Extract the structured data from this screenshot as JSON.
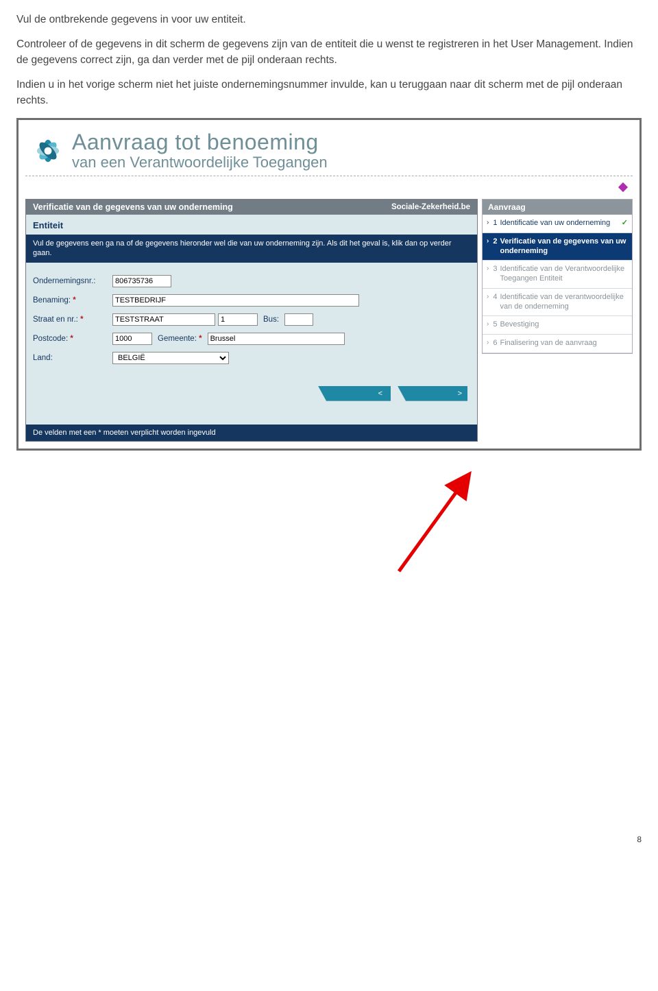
{
  "doc": {
    "para1": "Vul de ontbrekende gegevens in voor uw entiteit.",
    "para2": "Controleer of de gegevens in dit scherm de gegevens zijn van de entiteit die u wenst te registreren in het User Management. Indien de gegevens correct zijn, ga dan verder met de pijl onderaan rechts.",
    "para3": "Indien u in het vorige scherm niet het juiste ondernemingsnummer invulde, kan u teruggaan naar dit scherm met de pijl onderaan rechts.",
    "page_number": "8"
  },
  "header": {
    "title_big": "Aanvraag tot benoeming",
    "title_small": "van een Verantwoordelijke Toegangen"
  },
  "panel": {
    "title": "Verificatie van de gegevens van uw onderneming",
    "site": "Sociale-Zekerheid.be",
    "section": "Entiteit",
    "instruction": "Vul de gegevens een ga na of de gegevens hieronder wel die van uw onderneming zijn. Als dit het geval is, klik dan op verder gaan.",
    "mandatory": "De velden met een * moeten verplicht worden ingevuld"
  },
  "form": {
    "ondernemingsnr_label": "Ondernemingsnr.:",
    "ondernemingsnr_value": "806735736",
    "benaming_label": "Benaming:",
    "benaming_value": "TESTBEDRIJF",
    "straat_label": "Straat en nr.:",
    "straat_value": "TESTSTRAAT",
    "nr_value": "1",
    "bus_label": "Bus:",
    "bus_value": "",
    "postcode_label": "Postcode:",
    "postcode_value": "1000",
    "gemeente_label": "Gemeente:",
    "gemeente_value": "Brussel",
    "land_label": "Land:",
    "land_value": "BELGIË",
    "star": "*"
  },
  "nav": {
    "back": "<",
    "next": ">"
  },
  "sidebar": {
    "title": "Aanvraag",
    "steps": [
      {
        "num": "1",
        "label": "Identificatie van uw onderneming",
        "done": true
      },
      {
        "num": "2",
        "label": "Verificatie van de gegevens van uw onderneming",
        "active": true
      },
      {
        "num": "3",
        "label": "Identificatie van de Verantwoordelijke Toegangen Entiteit"
      },
      {
        "num": "4",
        "label": "Identificatie van de verantwoordelijke van de onderneming"
      },
      {
        "num": "5",
        "label": "Bevestiging"
      },
      {
        "num": "6",
        "label": "Finalisering van de aanvraag"
      }
    ]
  }
}
